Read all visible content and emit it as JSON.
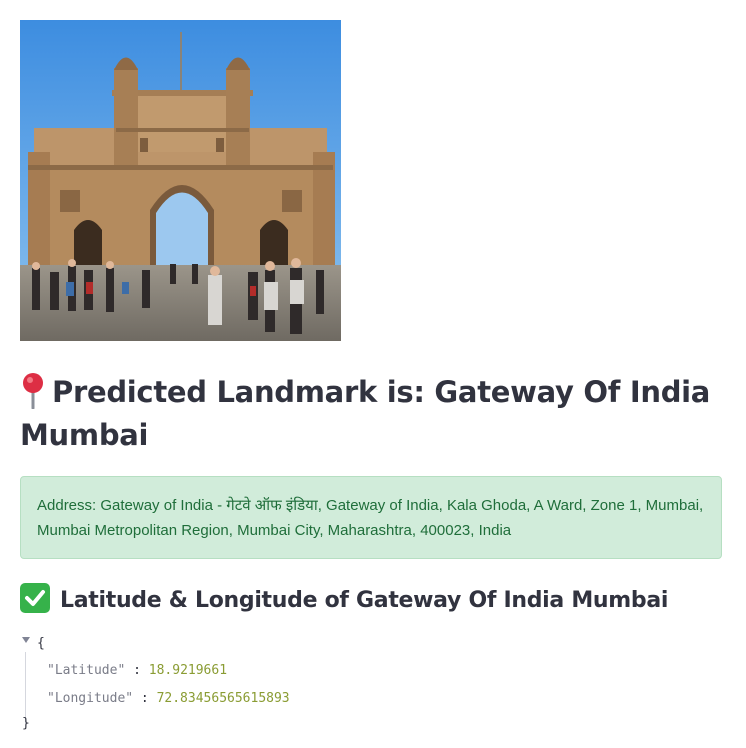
{
  "image": {
    "alt": "Gateway of India photo"
  },
  "prediction": {
    "pin_icon": "round-pushpin-icon",
    "heading_prefix": "Predicted Landmark is: ",
    "landmark": "Gateway Of India Mumbai"
  },
  "address": {
    "text": "Address: Gateway of India - गेटवे ऑफ इंडिया, Gateway of India, Kala Ghoda, A Ward, Zone 1, Mumbai, Mumbai Metropolitan Region, Mumbai City, Maharashtra, 400023, India",
    "bg_color": "#d1ecda",
    "text_color": "#1f6e3a"
  },
  "coordinates": {
    "check_icon": "check-mark-button-icon",
    "heading": "Latitude & Longitude of Gateway Of India Mumbai",
    "json": {
      "open_brace": "{",
      "close_brace": "}",
      "lat_key": "\"Latitude\"",
      "lat_value": "18.9219661",
      "lng_key": "\"Longitude\"",
      "lng_value": "72.83456565615893"
    }
  }
}
